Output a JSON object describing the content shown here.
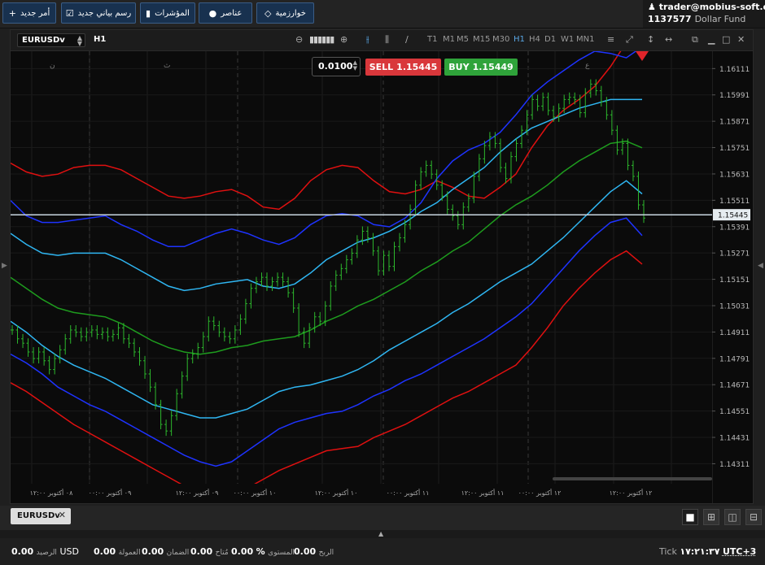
{
  "toolbar": {
    "buttons": [
      {
        "label": "أمر جديد",
        "icon": "plus-icon",
        "glyph": "+"
      },
      {
        "label": "رسم بياني جديد",
        "icon": "chart-icon",
        "glyph": "☑"
      },
      {
        "label": "المؤشرات",
        "icon": "indicators-icon",
        "glyph": "▮"
      },
      {
        "label": "عناصر",
        "icon": "elements-icon",
        "glyph": "●"
      },
      {
        "label": "خوارزمية",
        "icon": "algorithm-icon",
        "glyph": "◇"
      }
    ]
  },
  "account": {
    "user": "trader@mobius-soft.org",
    "balance": "1137577",
    "currency_name": "Dollar Fund"
  },
  "chart_window": {
    "symbol": "EURUSDv",
    "timeframe": "H1",
    "timeframes": [
      "T1",
      "M1",
      "M5",
      "M15",
      "M30",
      "H1",
      "H4",
      "D1",
      "W1",
      "MN1"
    ],
    "active_timeframe": "H1"
  },
  "order_panel": {
    "lot": "0.0100",
    "sell_label": "SELL",
    "sell_price": "1.15445",
    "buy_label": "BUY",
    "buy_price": "1.15449"
  },
  "chart_data": {
    "type": "candlestick",
    "current_price": 1.15445,
    "ylim": [
      1.1422,
      1.1619
    ],
    "price_ticks": [
      "1.16111",
      "1.15991",
      "1.15871",
      "1.15751",
      "1.15631",
      "1.15511",
      "1.15391",
      "1.15271",
      "1.15151",
      "1.15031",
      "1.14911",
      "1.14791",
      "1.14671",
      "1.14551",
      "1.14431",
      "1.14311"
    ],
    "time_labels": [
      "٠٨ أكتوبر ١٢:٠٠",
      "٠٩ أكتوبر ٠٠:٠٠",
      "٠٩ أكتوبر ١٢:٠٠",
      "١٠ أكتوبر ٠٠:٠٠",
      "١٠ أكتوبر ١٢:٠٠",
      "١١ أكتوبر ٠٠:٠٠",
      "١١ أكتوبر ١٢:٠٠",
      "١٢ أكتوبر ٠٠:٠٠",
      "١٢ أكتوبر ١٢:٠٠"
    ],
    "day_markers": [
      "ن",
      "ث",
      "ع"
    ],
    "series": [
      {
        "role": "red-upper",
        "color": "#e01010",
        "values": [
          1.1568,
          1.1564,
          1.1562,
          1.1563,
          1.1566,
          1.1567,
          1.1567,
          1.1565,
          1.1561,
          1.1557,
          1.1553,
          1.1552,
          1.1553,
          1.1555,
          1.1556,
          1.1553,
          1.1548,
          1.1547,
          1.1552,
          1.156,
          1.1565,
          1.1567,
          1.1566,
          1.156,
          1.1555,
          1.1554,
          1.1556,
          1.156,
          1.1557,
          1.1553,
          1.1552,
          1.1557,
          1.1563,
          1.1575,
          1.1585,
          1.1592,
          1.1597,
          1.1603,
          1.1612,
          1.1623,
          1.1633
        ]
      },
      {
        "role": "blue-upper",
        "color": "#1e33ff",
        "values": [
          1.1551,
          1.1544,
          1.1541,
          1.1541,
          1.1542,
          1.1543,
          1.1544,
          1.154,
          1.1537,
          1.1533,
          1.153,
          1.153,
          1.1533,
          1.1536,
          1.1538,
          1.1536,
          1.1533,
          1.1531,
          1.1534,
          1.154,
          1.1544,
          1.1545,
          1.1544,
          1.154,
          1.1539,
          1.1543,
          1.155,
          1.1561,
          1.1569,
          1.1574,
          1.1577,
          1.1582,
          1.159,
          1.1599,
          1.1605,
          1.161,
          1.1615,
          1.1619,
          1.1618,
          1.1616,
          1.1621
        ]
      },
      {
        "role": "lightblue-upper",
        "color": "#2fb6f2",
        "values": [
          1.1536,
          1.1531,
          1.1527,
          1.1526,
          1.1527,
          1.1527,
          1.1527,
          1.1524,
          1.152,
          1.1516,
          1.1512,
          1.151,
          1.1511,
          1.1513,
          1.1514,
          1.1515,
          1.1512,
          1.1511,
          1.1513,
          1.1518,
          1.1524,
          1.1528,
          1.1532,
          1.1534,
          1.1537,
          1.1541,
          1.1546,
          1.155,
          1.1556,
          1.1561,
          1.1566,
          1.1573,
          1.1579,
          1.1584,
          1.1587,
          1.159,
          1.1593,
          1.1595,
          1.1597,
          1.1597,
          1.1597
        ]
      },
      {
        "role": "green-middle",
        "color": "#1e9c1e",
        "values": [
          1.1516,
          1.1511,
          1.1506,
          1.1502,
          1.15,
          1.1499,
          1.1498,
          1.1495,
          1.1491,
          1.1487,
          1.1484,
          1.1482,
          1.1481,
          1.1482,
          1.1484,
          1.1485,
          1.1487,
          1.1488,
          1.1489,
          1.1492,
          1.1496,
          1.1499,
          1.1503,
          1.1506,
          1.151,
          1.1514,
          1.1519,
          1.1523,
          1.1528,
          1.1532,
          1.1538,
          1.1544,
          1.1549,
          1.1553,
          1.1558,
          1.1564,
          1.1569,
          1.1573,
          1.1577,
          1.1578,
          1.1575
        ]
      },
      {
        "role": "lightblue-lower",
        "color": "#2fb6f2",
        "values": [
          1.1496,
          1.1491,
          1.1485,
          1.148,
          1.1476,
          1.1473,
          1.147,
          1.1466,
          1.1462,
          1.1458,
          1.1456,
          1.1454,
          1.1452,
          1.1452,
          1.1454,
          1.1456,
          1.146,
          1.1464,
          1.1466,
          1.1467,
          1.1469,
          1.1471,
          1.1474,
          1.1478,
          1.1483,
          1.1487,
          1.1491,
          1.1495,
          1.15,
          1.1504,
          1.1509,
          1.1514,
          1.1518,
          1.1522,
          1.1528,
          1.1534,
          1.1541,
          1.1548,
          1.1555,
          1.156,
          1.1554
        ]
      },
      {
        "role": "blue-lower",
        "color": "#1e33ff",
        "values": [
          1.1481,
          1.1477,
          1.1472,
          1.1466,
          1.1462,
          1.1458,
          1.1455,
          1.1451,
          1.1447,
          1.1443,
          1.1439,
          1.1435,
          1.1432,
          1.143,
          1.1432,
          1.1437,
          1.1442,
          1.1447,
          1.145,
          1.1452,
          1.1454,
          1.1455,
          1.1458,
          1.1462,
          1.1465,
          1.1469,
          1.1472,
          1.1476,
          1.148,
          1.1484,
          1.1488,
          1.1493,
          1.1498,
          1.1504,
          1.1512,
          1.152,
          1.1528,
          1.1535,
          1.1541,
          1.1543,
          1.1535
        ]
      },
      {
        "role": "red-lower",
        "color": "#e01010",
        "values": [
          1.1468,
          1.1464,
          1.1459,
          1.1454,
          1.1449,
          1.1445,
          1.1441,
          1.1437,
          1.1433,
          1.1429,
          1.1425,
          1.1421,
          1.1418,
          1.1416,
          1.1417,
          1.142,
          1.1424,
          1.1428,
          1.1431,
          1.1434,
          1.1437,
          1.1438,
          1.1439,
          1.1443,
          1.1446,
          1.1449,
          1.1453,
          1.1457,
          1.1461,
          1.1464,
          1.1468,
          1.1472,
          1.1476,
          1.1484,
          1.1493,
          1.1503,
          1.1511,
          1.1518,
          1.1524,
          1.1528,
          1.1522
        ]
      }
    ],
    "candles": [
      1.1492,
      1.1488,
      1.1486,
      1.1482,
      1.1479,
      1.1482,
      1.1478,
      1.1474,
      1.1479,
      1.1483,
      1.1488,
      1.1492,
      1.1491,
      1.1489,
      1.1491,
      1.1492,
      1.149,
      1.1491,
      1.1489,
      1.149,
      1.1493,
      1.1488,
      1.1486,
      1.1482,
      1.1478,
      1.1472,
      1.1466,
      1.1458,
      1.1449,
      1.1446,
      1.1453,
      1.1463,
      1.1471,
      1.1479,
      1.1481,
      1.1484,
      1.1489,
      1.1496,
      1.1494,
      1.1491,
      1.1489,
      1.1488,
      1.1492,
      1.1497,
      1.1504,
      1.1511,
      1.1514,
      1.1516,
      1.1512,
      1.1514,
      1.1516,
      1.1514,
      1.1509,
      1.1502,
      1.1491,
      1.1486,
      1.1493,
      1.1498,
      1.1496,
      1.1503,
      1.1512,
      1.1517,
      1.152,
      1.1524,
      1.1527,
      1.1533,
      1.1537,
      1.1534,
      1.1528,
      1.1519,
      1.1526,
      1.1521,
      1.153,
      1.1534,
      1.154,
      1.1547,
      1.1558,
      1.1564,
      1.1567,
      1.1563,
      1.1558,
      1.1553,
      1.1547,
      1.1544,
      1.154,
      1.1548,
      1.1552,
      1.1562,
      1.157,
      1.1576,
      1.158,
      1.1577,
      1.1566,
      1.1561,
      1.1571,
      1.1577,
      1.1583,
      1.159,
      1.1597,
      1.1594,
      1.1598,
      1.1592,
      1.1589,
      1.1593,
      1.1597,
      1.1598,
      1.1597,
      1.1591,
      1.16,
      1.1604,
      1.1601,
      1.1596,
      1.159,
      1.1583,
      1.1574,
      1.1577,
      1.1567,
      1.1562,
      1.1549,
      1.1543
    ]
  },
  "bottom": {
    "tab": "EURUSDv",
    "status": [
      {
        "value": "0.00",
        "unit": "USD",
        "label": "الرصيد"
      },
      {
        "value": "0.00",
        "label": "العمولة"
      },
      {
        "value": "0.00",
        "label": "الضمان"
      },
      {
        "value": "0.00",
        "label": "مُتاح"
      },
      {
        "value": "0.00",
        "unit": "%",
        "label": "المستوى"
      },
      {
        "value": "0.00",
        "label": "الربح"
      }
    ],
    "tick_label": "Tick",
    "time": "١٧:٢١:٣٧",
    "timezone": "UTC+3"
  }
}
